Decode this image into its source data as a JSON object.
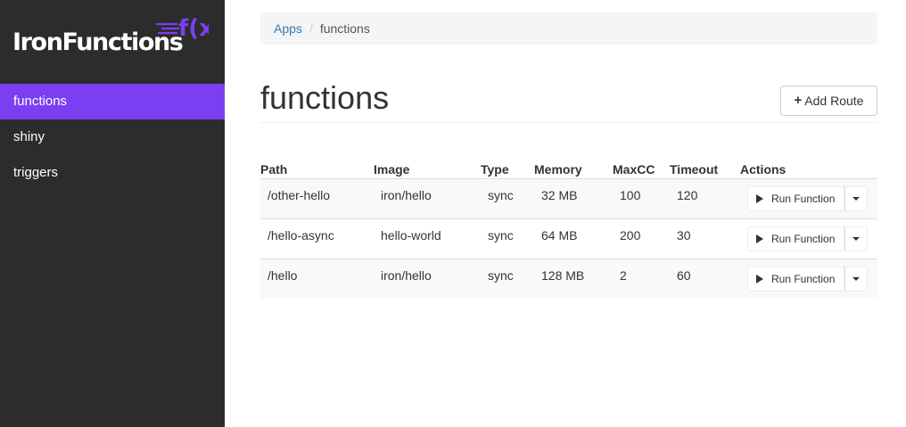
{
  "app": {
    "logo_text": "IronFunctions",
    "logo_mark_text": "f(x)",
    "brand_color": "#7b3ff2"
  },
  "sidebar": {
    "items": [
      {
        "label": "functions",
        "active": true
      },
      {
        "label": "shiny",
        "active": false
      },
      {
        "label": "triggers",
        "active": false
      }
    ]
  },
  "breadcrumb": {
    "root": "Apps",
    "separator": "/",
    "current": "functions"
  },
  "page": {
    "title": "functions",
    "add_route_label": "Add Route",
    "add_route_icon": "plus-icon"
  },
  "table": {
    "headers": [
      "Path",
      "Image",
      "Type",
      "Memory",
      "MaxCC",
      "Timeout",
      "Actions"
    ],
    "rows": [
      {
        "path": "/other-hello",
        "image": "iron/hello",
        "type": "sync",
        "memory": "32 MB",
        "maxcc": "100",
        "timeout": "120",
        "action_label": "Run Function"
      },
      {
        "path": "/hello-async",
        "image": "hello-world",
        "type": "sync",
        "memory": "64 MB",
        "maxcc": "200",
        "timeout": "30",
        "action_label": "Run Function"
      },
      {
        "path": "/hello",
        "image": "iron/hello",
        "type": "sync",
        "memory": "128 MB",
        "maxcc": "2",
        "timeout": "60",
        "action_label": "Run Function"
      }
    ]
  }
}
